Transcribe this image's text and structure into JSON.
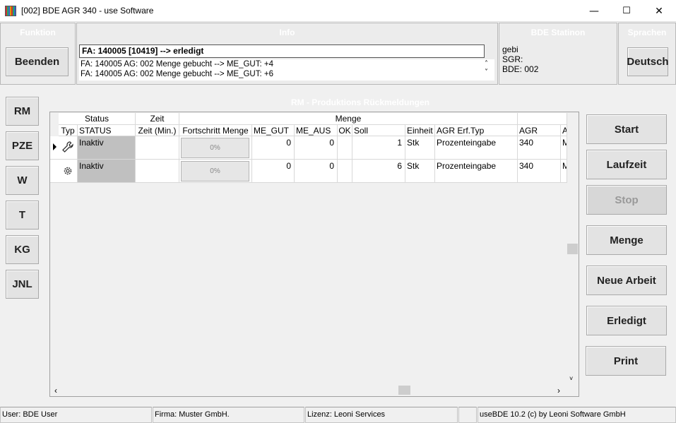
{
  "window": {
    "title": "[002] BDE AGR 340 - use Software",
    "minimize": "—",
    "maximize": "☐",
    "close": "✕"
  },
  "funktion": {
    "header": "Funktion",
    "beenden": "Beenden"
  },
  "info": {
    "header": "Info",
    "current": "FA: 140005 [10419] --> erledigt",
    "log": [
      "FA: 140005 AG: 002 Menge gebucht --> ME_GUT: +4",
      "FA: 140005 AG: 002 Menge gebucht --> ME_GUT: +6"
    ]
  },
  "station": {
    "header": "BDE Statinon",
    "lines": [
      "gebi",
      "SGR:",
      "BDE: 002"
    ]
  },
  "sprachen": {
    "header": "Sprachen",
    "button": "Deutsch"
  },
  "left_nav": [
    "RM",
    "PZE",
    "W",
    "T",
    "KG",
    "JNL"
  ],
  "rm_title": "RM - Produktions Rückmeldungen",
  "grid": {
    "groups": {
      "status": "Status",
      "zeit": "Zeit",
      "menge": "Menge"
    },
    "columns": [
      "Typ",
      "STATUS",
      "Zeit (Min.)",
      "Fortschritt Menge",
      "ME_GUT",
      "ME_AUS",
      "OK",
      "Soll",
      "Einheit",
      "AGR Erf.Typ",
      "AGR",
      "A"
    ],
    "rows": [
      {
        "status": "Inaktiv",
        "zeit": "",
        "progress_label": "0%",
        "progress": 0,
        "me_gut": "0",
        "me_aus": "0",
        "ok": "",
        "soll": "1",
        "einheit": "Stk",
        "erf_typ": "Prozenteingabe",
        "agr": "340",
        "a": "M",
        "icon": "wrench-icon",
        "selected": true
      },
      {
        "status": "Inaktiv",
        "zeit": "",
        "progress_label": "0%",
        "progress": 0,
        "me_gut": "0",
        "me_aus": "0",
        "ok": "",
        "soll": "6",
        "einheit": "Stk",
        "erf_typ": "Prozenteingabe",
        "agr": "340",
        "a": "M",
        "icon": "gear-icon",
        "selected": false
      }
    ]
  },
  "actions": {
    "start": "Start",
    "laufzeit": "Laufzeit",
    "stop": "Stop",
    "menge": "Menge",
    "neue_arbeit": "Neue Arbeit",
    "erledigt": "Erledigt",
    "print": "Print"
  },
  "statusbar": {
    "user": "User: BDE User",
    "firma": "Firma: Muster GmbH.",
    "lizenz": "Lizenz: Leoni Services",
    "empty": "",
    "version": "useBDE 10.2 (c) by Leoni Software GmbH"
  },
  "colors": {
    "panel_header_text": "#ffffff",
    "status_cell": "#c0c0c0"
  }
}
